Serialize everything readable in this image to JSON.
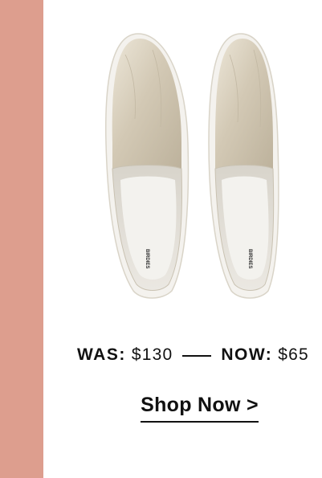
{
  "brand": {
    "band_color": "#dd9e8e",
    "insole_brand": "BIRDIES"
  },
  "product": {
    "image_icon": "gold-slip-on-shoes-image",
    "color": "#d9d0bf"
  },
  "pricing": {
    "was_label": "WAS:",
    "was_price": "$130",
    "now_label": "NOW:",
    "now_price": "$65"
  },
  "cta": {
    "shop_now_label": "Shop Now >"
  }
}
